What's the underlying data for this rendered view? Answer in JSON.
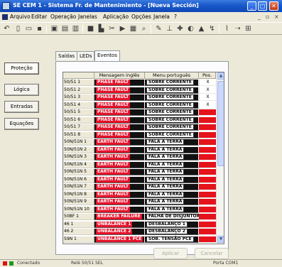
{
  "window": {
    "title": "SE CEM 1 - Sistema Fr. de Mantenimiento - [Nueva Sección]",
    "minimize_glyph": "_",
    "maximize_glyph": "□",
    "close_glyph": "✕"
  },
  "menu": {
    "items": [
      "Arquivo",
      "Editar",
      "Operação",
      "Janelas",
      "Aplicação",
      "Opções",
      "Janela",
      "?"
    ],
    "mdi_minimize": "_",
    "mdi_restore": "▫",
    "mdi_close": "×"
  },
  "toolbar": {
    "icons": [
      "back-icon",
      "new-document-icon",
      "open-folder-icon",
      "save-icon",
      "copy-icon",
      "paste-icon",
      "print-icon",
      "monitor-icon",
      "chart-icon",
      "cut-icon",
      "play-icon",
      "grid-icon",
      "zoom-icon",
      "wrench-icon",
      "measure-icon",
      "plus-icon",
      "meter-icon",
      "warning-icon",
      "signal-icon",
      "antenna-icon",
      "arrow-icon",
      "help-icon"
    ]
  },
  "left_nav": {
    "items": [
      "Proteção",
      "Lógica",
      "Entradas",
      "Equações"
    ]
  },
  "tabs": [
    "Saídas",
    "LEDs",
    "Eventos"
  ],
  "grid": {
    "headers": [
      "",
      "Mensagem inglês",
      "Menu português",
      "Pos."
    ],
    "rows": [
      {
        "id": "50/51 1",
        "en": "PHASE FAULT",
        "pt": "SOBRE CORRENTE",
        "pos": "X",
        "flag": "white"
      },
      {
        "id": "50/51 2",
        "en": "PHASE FAULT",
        "pt": "SOBRE CORRENTE",
        "pos": "X",
        "flag": "white"
      },
      {
        "id": "50/51 3",
        "en": "PHASE FAULT",
        "pt": "SOBRE CORRENTE",
        "pos": "X",
        "flag": "white"
      },
      {
        "id": "50/51 4",
        "en": "PHASE FAULT",
        "pt": "SOBRE CORRENTE",
        "pos": "X",
        "flag": "white"
      },
      {
        "id": "50/51 5",
        "en": "PHASE FAULT",
        "pt": "SOBRE CORRENTE",
        "pos": "",
        "flag": "red"
      },
      {
        "id": "50/51 6",
        "en": "PHASE FAULT",
        "pt": "SOBRE CORRENTE",
        "pos": "",
        "flag": "red"
      },
      {
        "id": "50/51 7",
        "en": "PHASE FAULT",
        "pt": "SOBRE CORRENTE",
        "pos": "",
        "flag": "red"
      },
      {
        "id": "50/51 8",
        "en": "PHASE FAULT",
        "pt": "SOBRE CORRENTE",
        "pos": "",
        "flag": "red"
      },
      {
        "id": "50N/51N 1",
        "en": "EARTH FAULT",
        "pt": "FALA A TERRA",
        "pos": "",
        "flag": "red"
      },
      {
        "id": "50N/51N 2",
        "en": "EARTH FAULT",
        "pt": "FALA A TERRA",
        "pos": "",
        "flag": "red"
      },
      {
        "id": "50N/51N 3",
        "en": "EARTH FAULT",
        "pt": "FALA A TERRA",
        "pos": "",
        "flag": "red"
      },
      {
        "id": "50N/51N 4",
        "en": "EARTH FAULT",
        "pt": "FALA A TERRA",
        "pos": "",
        "flag": "red"
      },
      {
        "id": "50N/51N 5",
        "en": "EARTH FAULT",
        "pt": "FALA A TERRA",
        "pos": "",
        "flag": "red"
      },
      {
        "id": "50N/51N 6",
        "en": "EARTH FAULT",
        "pt": "FALA A TERRA",
        "pos": "",
        "flag": "red"
      },
      {
        "id": "50N/51N 7",
        "en": "EARTH FAULT",
        "pt": "FALA A TERRA",
        "pos": "",
        "flag": "red"
      },
      {
        "id": "50N/51N 8",
        "en": "EARTH FAULT",
        "pt": "FALA A TERRA",
        "pos": "",
        "flag": "red"
      },
      {
        "id": "50N/51N 9",
        "en": "EARTH FAULT",
        "pt": "FALA A TERRA",
        "pos": "",
        "flag": "red"
      },
      {
        "id": "50N/51N 10",
        "en": "EARTH FAULT",
        "pt": "FALA A TERRA",
        "pos": "",
        "flag": "red"
      },
      {
        "id": "50BF 1",
        "en": "BREAKER FAILURE",
        "pt": "FALHA DE DISJUNTOR",
        "pos": "",
        "flag": "red"
      },
      {
        "id": "46 1",
        "en": "UNBALANCE 1",
        "pt": "DESBALANÇO 1",
        "pos": "",
        "flag": "red"
      },
      {
        "id": "46 2",
        "en": "UNBALANCE 2",
        "pt": "DESBALANÇO 2",
        "pos": "",
        "flag": "red"
      },
      {
        "id": "59N 1",
        "en": "UNBALANCE 1 PCE",
        "pt": "SOB. TENSÃO PCE",
        "pos": "",
        "flag": "red"
      }
    ]
  },
  "buttons": {
    "apply": "Aplicar",
    "cancel": "Cancelar"
  },
  "status": {
    "left": "Conectado",
    "mid": "Relé 50/51 SEL",
    "right": "Porta COM1"
  }
}
